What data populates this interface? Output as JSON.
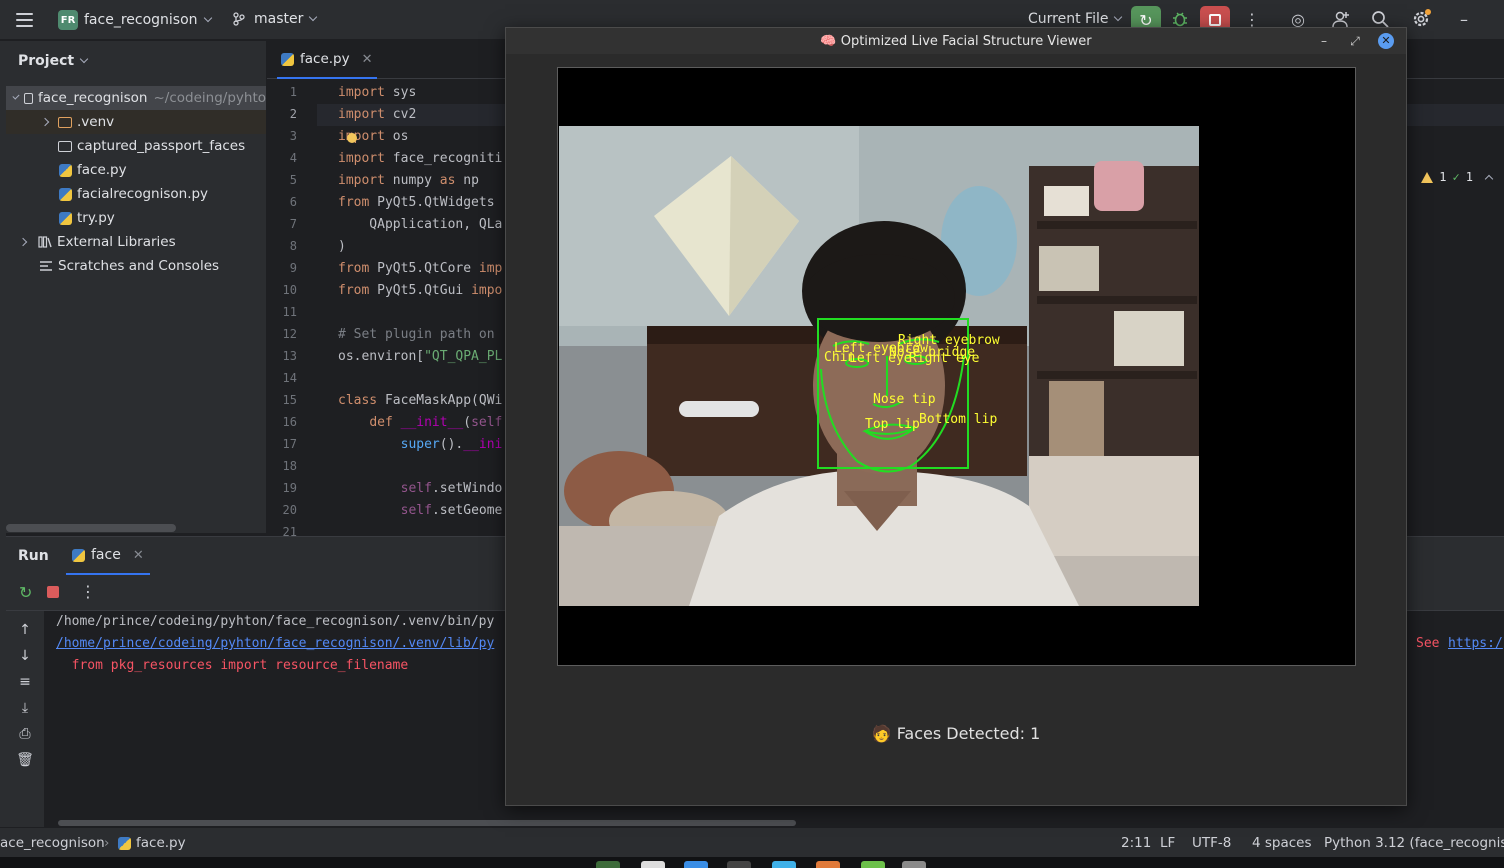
{
  "topbar": {
    "project_badge": "FR",
    "project_name": "face_recognison",
    "branch": "master",
    "run_config": "Current File"
  },
  "project_panel": {
    "title": "Project",
    "root": {
      "name": "face_recognison",
      "path": "~/codeing/pyhto"
    },
    "items": [
      {
        "label": ".venv"
      },
      {
        "label": "captured_passport_faces"
      },
      {
        "label": "face.py"
      },
      {
        "label": "facialrecognison.py"
      },
      {
        "label": "try.py"
      }
    ],
    "external_libraries": "External Libraries",
    "scratches": "Scratches and Consoles"
  },
  "editor": {
    "tab_label": "face.py",
    "inspections": {
      "warnings": "1",
      "ok": "1"
    },
    "line_numbers": [
      "1",
      "2",
      "3",
      "4",
      "5",
      "6",
      "7",
      "8",
      "9",
      "10",
      "11",
      "12",
      "13",
      "14",
      "15",
      "16",
      "17",
      "18",
      "19",
      "20",
      "21"
    ],
    "current_line": "2"
  },
  "run": {
    "title": "Run",
    "tab_label": "face",
    "output": {
      "line1": "/home/prince/codeing/pyhton/face_recognison/.venv/bin/py",
      "line2_link": "/home/prince/codeing/pyhton/face_recognison/.venv/lib/py",
      "line2_see": "See",
      "line2_url": "https:/",
      "line3": "  from pkg_resources import resource_filename"
    }
  },
  "statusbar": {
    "breadcrumb_project": "ace_recognison",
    "breadcrumb_file": "face.py",
    "position": "2:11",
    "line_sep": "LF",
    "encoding": "UTF-8",
    "indent": "4 spaces",
    "interpreter": "Python 3.12 (face_recognison"
  },
  "viewer": {
    "title": "🧠 Optimized Live Facial Structure Viewer",
    "faces_detected": "🧑 Faces Detected: 1",
    "landmark_labels": {
      "right_eyebrow": "Right eyebrow",
      "left_eyebrow": "Left eyebrow",
      "nose_bridge": "Nose bridge",
      "chin": "Chin",
      "left_eye": "Left eye",
      "right_eye": "Right eye",
      "nose_tip": "Nose tip",
      "top_lip": "Top lip",
      "bottom_lip": "Bottom lip"
    },
    "overlay_colors": {
      "box": "#22dd22",
      "label": "#ffff33"
    }
  }
}
